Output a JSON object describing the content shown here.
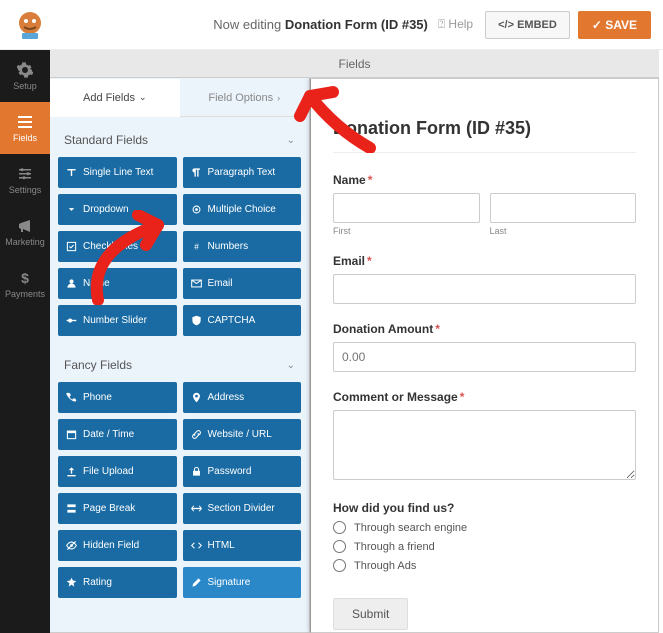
{
  "topbar": {
    "now_editing_prefix": "Now editing",
    "form_name": "Donation Form (ID #35)",
    "help": "Help",
    "embed": "EMBED",
    "save": "SAVE"
  },
  "rail": [
    {
      "key": "setup",
      "label": "Setup"
    },
    {
      "key": "fields",
      "label": "Fields"
    },
    {
      "key": "settings",
      "label": "Settings"
    },
    {
      "key": "marketing",
      "label": "Marketing"
    },
    {
      "key": "payments",
      "label": "Payments"
    }
  ],
  "ribbon": "Fields",
  "tabs": {
    "add_fields": "Add Fields",
    "field_options": "Field Options"
  },
  "sections": {
    "standard": {
      "title": "Standard Fields",
      "items": [
        {
          "label": "Single Line Text",
          "icon": "text-icon"
        },
        {
          "label": "Paragraph Text",
          "icon": "paragraph-icon"
        },
        {
          "label": "Dropdown",
          "icon": "dropdown-icon"
        },
        {
          "label": "Multiple Choice",
          "icon": "radio-icon"
        },
        {
          "label": "Checkboxes",
          "icon": "checkbox-icon"
        },
        {
          "label": "Numbers",
          "icon": "hash-icon"
        },
        {
          "label": "Name",
          "icon": "user-icon"
        },
        {
          "label": "Email",
          "icon": "mail-icon"
        },
        {
          "label": "Number Slider",
          "icon": "slider-icon"
        },
        {
          "label": "CAPTCHA",
          "icon": "shield-icon"
        }
      ]
    },
    "fancy": {
      "title": "Fancy Fields",
      "items": [
        {
          "label": "Phone",
          "icon": "phone-icon"
        },
        {
          "label": "Address",
          "icon": "pin-icon"
        },
        {
          "label": "Date / Time",
          "icon": "calendar-icon"
        },
        {
          "label": "Website / URL",
          "icon": "link-icon"
        },
        {
          "label": "File Upload",
          "icon": "upload-icon"
        },
        {
          "label": "Password",
          "icon": "lock-icon"
        },
        {
          "label": "Page Break",
          "icon": "break-icon"
        },
        {
          "label": "Section Divider",
          "icon": "divider-icon"
        },
        {
          "label": "Hidden Field",
          "icon": "eye-off-icon"
        },
        {
          "label": "HTML",
          "icon": "code-icon"
        },
        {
          "label": "Rating",
          "icon": "star-icon"
        },
        {
          "label": "Signature",
          "icon": "pen-icon"
        }
      ]
    }
  },
  "preview": {
    "title": "Donation Form (ID #35)",
    "name_label": "Name",
    "first_sub": "First",
    "last_sub": "Last",
    "email_label": "Email",
    "donation_label": "Donation Amount",
    "donation_placeholder": "0.00",
    "comment_label": "Comment or Message",
    "findus_label": "How did you find us?",
    "findus_options": [
      "Through search engine",
      "Through a friend",
      "Through Ads"
    ],
    "submit": "Submit"
  }
}
